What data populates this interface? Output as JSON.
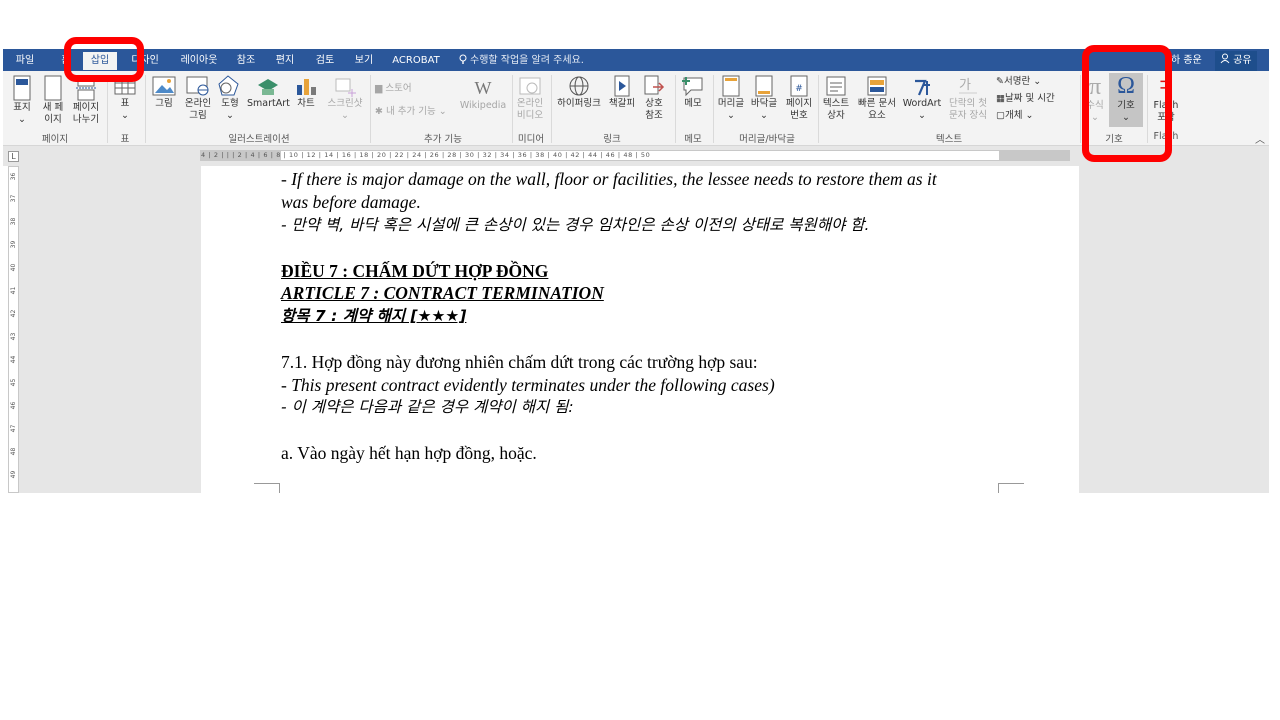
{
  "tabs": [
    {
      "label": "파일",
      "active": false
    },
    {
      "label": "홈",
      "active": false
    },
    {
      "label": "삽입",
      "active": true
    },
    {
      "label": "디자인",
      "active": false
    },
    {
      "label": "레이아웃",
      "active": false
    },
    {
      "label": "참조",
      "active": false
    },
    {
      "label": "편지",
      "active": false
    },
    {
      "label": "검토",
      "active": false
    },
    {
      "label": "보기",
      "active": false
    },
    {
      "label": "ACROBAT",
      "active": false
    }
  ],
  "tell_me": "수행할 작업을 알려 주세요.",
  "user": "하 종운",
  "share": "공유",
  "ribbon": {
    "pages": {
      "cover": "표지",
      "blank": "새 페\n이지",
      "break": "페이지\n나누기",
      "group": "페이지"
    },
    "table": {
      "table": "표",
      "group": "표"
    },
    "illustrations": {
      "picture": "그림",
      "online_picture": "온라인\n그림",
      "shapes": "도형",
      "smartart": "SmartArt",
      "chart": "차트",
      "screenshot": "스크린샷",
      "group": "일러스트레이션"
    },
    "addins": {
      "store": "스토어",
      "my_addins": "내 추가 기능",
      "wikipedia": "Wikipedia",
      "group": "추가 기능"
    },
    "media": {
      "online_video": "온라인\n비디오",
      "group": "미디어"
    },
    "links": {
      "hyperlink": "하이퍼링크",
      "bookmark": "책갈피",
      "crossref": "상호\n참조",
      "group": "링크"
    },
    "comments": {
      "comment": "메모",
      "group": "메모"
    },
    "header_footer": {
      "header": "머리글",
      "footer": "바닥글",
      "page_number": "페이지\n번호",
      "group": "머리글/바닥글"
    },
    "text": {
      "textbox": "텍스트\n상자",
      "quickparts": "빠른 문서\n요소",
      "wordart": "WordArt",
      "dropcap": "단락의 첫\n문자 장식",
      "signature": "서명란",
      "datetime": "날짜 및 시간",
      "object": "개체",
      "group": "텍스트"
    },
    "symbols": {
      "equation": "수식",
      "symbol": "기호",
      "group": "기호"
    },
    "flash": {
      "flash": "Flash\n포함",
      "group": "Flash"
    }
  },
  "ruler_numbers": "4 | 2 | | | 2 | 4 | 6 | 8 | 10 | 12 | 14 | 16 | 18 | 20 | 22 | 24 | 26 | 28 | 30 | 32 | 34 | 36 | 38 | 40 | 42 | 44 | 46 | 48 | 50",
  "vruler_numbers": [
    "36",
    "37",
    "38",
    "39",
    "40",
    "41",
    "42",
    "43",
    "44",
    "45",
    "46",
    "47",
    "48",
    "49"
  ],
  "document": {
    "l1": "- If there is major damage on the wall, floor or facilities, the lessee needs to restore them as it",
    "l2": "was before damage.",
    "l3": "- 만약 벽, 바닥 혹은 시설에 큰 손상이 있는 경우 임차인은 손상 이전의 상태로 복원해야 함.",
    "h1": "ĐIỀU 7 : CHẤM DỨT HỢP ĐỒNG",
    "h2": "ARTICLE 7 : CONTRACT TERMINATION",
    "h3": "항목 7 : 계약 해지 [★★★]",
    "p1": "7.1. Hợp đồng này đương nhiên chấm dứt trong các trường hợp sau:",
    "p2": "- This present contract evidently terminates under the following cases)",
    "p3": "- 이 계약은 다음과 같은 경우 계약이 해지 됨:",
    "p4": "a. Vào ngày hết hạn hợp đồng, hoặc."
  },
  "colors": {
    "tabbar": "#2b579a",
    "ribbon": "#f3f3f3",
    "highlight": "#ff0000",
    "workspace": "#e6e6e6"
  }
}
